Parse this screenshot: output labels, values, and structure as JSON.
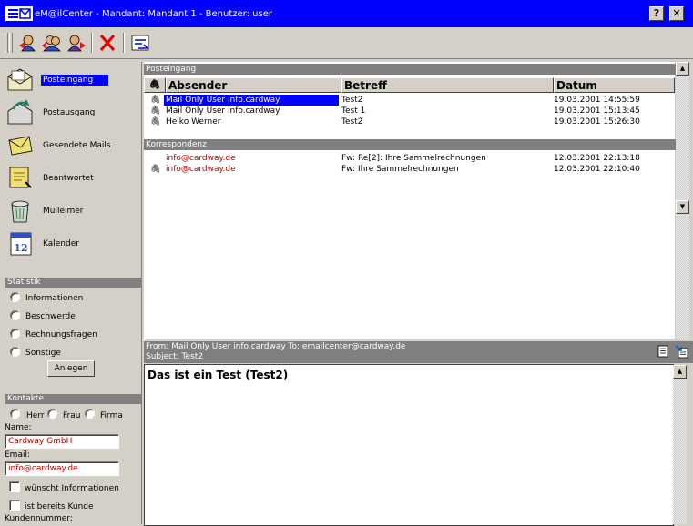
{
  "window": {
    "title": "eM@ilCenter - Mandant: Mandant 1 - Benutzer: user",
    "help_label": "?",
    "close_label": "✕"
  },
  "toolbar": {
    "icons": [
      "reply-icon",
      "reply-all-icon",
      "forward-icon",
      "delete-icon",
      "send-receive-icon"
    ]
  },
  "folders": [
    {
      "label": "Posteingang",
      "icon": "inbox-icon",
      "selected": true
    },
    {
      "label": "Postausgang",
      "icon": "outbox-icon",
      "selected": false
    },
    {
      "label": "Gesendete Mails",
      "icon": "sent-mail-icon",
      "selected": false
    },
    {
      "label": "Beantwortet",
      "icon": "answered-icon",
      "selected": false
    },
    {
      "label": "Mülleimer",
      "icon": "trash-icon",
      "selected": false
    },
    {
      "label": "Kalender",
      "icon": "calendar-icon",
      "selected": false
    }
  ],
  "calendar_day": "12",
  "statistik": {
    "heading": "Statistik",
    "options": [
      "Informationen",
      "Beschwerde",
      "Rechnungsfragen",
      "Sonstige"
    ],
    "button": "Anlegen"
  },
  "kontakte": {
    "heading": "Kontakte",
    "salutations": [
      "Herr",
      "Frau",
      "Firma"
    ],
    "name_label": "Name:",
    "name_value": "Cardway GmbH",
    "email_label": "Email:",
    "email_value": "info@cardway.de",
    "checkbox1": "wünscht Informationen",
    "checkbox2": "ist bereits Kunde",
    "kundennummer_label": "Kundennummer:"
  },
  "list": {
    "group1": "Posteingang",
    "columns": {
      "attachment": "🖇",
      "sender": "Absender",
      "subject": "Betreff",
      "date": "Datum"
    },
    "rows": [
      {
        "sender": "Mail Only User info.cardway",
        "subject": "Test2",
        "date": "19.03.2001 14:55:59",
        "selected": true
      },
      {
        "sender": "Mail Only User info.cardway",
        "subject": "Test 1",
        "date": "19.03.2001 15:13:45",
        "selected": false
      },
      {
        "sender": "Heiko Werner",
        "subject": "Test2",
        "date": "19.03.2001 15:26:30",
        "selected": false
      }
    ],
    "group2": "Korrespondenz",
    "rows2": [
      {
        "sender": "info@cardway.de",
        "subject": "Fw: Re[2]: Ihre Sammelrechnungen",
        "date": "12.03.2001 22:13:18",
        "attachment": false
      },
      {
        "sender": "info@cardway.de",
        "subject": "Fw: Ihre Sammelrechnungen",
        "date": "12.03.2001 22:10:40",
        "attachment": true
      }
    ]
  },
  "preview": {
    "header_line1": "From: Mail Only User info.cardway To: emailcenter@cardway.de",
    "header_line2": "Subject: Test2",
    "body": "Das ist ein Test (Test2)"
  },
  "colors": {
    "titlebar": "#0000fe",
    "selection": "#0000fe",
    "group_header": "#808080",
    "link_red": "#c00000",
    "chrome": "#d4d0c8"
  }
}
